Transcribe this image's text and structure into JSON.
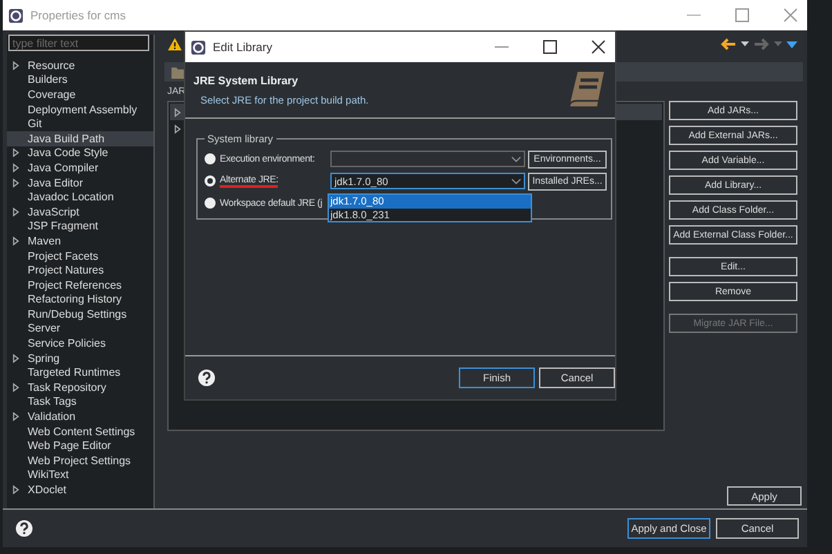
{
  "main_window": {
    "title": "Properties for cms",
    "filter": {
      "placeholder": "type filter text"
    },
    "tree": [
      {
        "label": "Resource",
        "expandable": true,
        "selected": false
      },
      {
        "label": "Builders",
        "expandable": false,
        "selected": false
      },
      {
        "label": "Coverage",
        "expandable": false,
        "selected": false
      },
      {
        "label": "Deployment Assembly",
        "expandable": false,
        "selected": false
      },
      {
        "label": "Git",
        "expandable": false,
        "selected": false
      },
      {
        "label": "Java Build Path",
        "expandable": false,
        "selected": true
      },
      {
        "label": "Java Code Style",
        "expandable": true,
        "selected": false
      },
      {
        "label": "Java Compiler",
        "expandable": true,
        "selected": false
      },
      {
        "label": "Java Editor",
        "expandable": true,
        "selected": false
      },
      {
        "label": "Javadoc Location",
        "expandable": false,
        "selected": false
      },
      {
        "label": "JavaScript",
        "expandable": true,
        "selected": false
      },
      {
        "label": "JSP Fragment",
        "expandable": false,
        "selected": false
      },
      {
        "label": "Maven",
        "expandable": true,
        "selected": false
      },
      {
        "label": "Project Facets",
        "expandable": false,
        "selected": false
      },
      {
        "label": "Project Natures",
        "expandable": false,
        "selected": false
      },
      {
        "label": "Project References",
        "expandable": false,
        "selected": false
      },
      {
        "label": "Refactoring History",
        "expandable": false,
        "selected": false
      },
      {
        "label": "Run/Debug Settings",
        "expandable": false,
        "selected": false
      },
      {
        "label": "Server",
        "expandable": false,
        "selected": false
      },
      {
        "label": "Service Policies",
        "expandable": false,
        "selected": false
      },
      {
        "label": "Spring",
        "expandable": true,
        "selected": false
      },
      {
        "label": "Targeted Runtimes",
        "expandable": false,
        "selected": false
      },
      {
        "label": "Task Repository",
        "expandable": true,
        "selected": false
      },
      {
        "label": "Task Tags",
        "expandable": false,
        "selected": false
      },
      {
        "label": "Validation",
        "expandable": true,
        "selected": false
      },
      {
        "label": "Web Content Settings",
        "expandable": false,
        "selected": false
      },
      {
        "label": "Web Page Editor",
        "expandable": false,
        "selected": false
      },
      {
        "label": "Web Project Settings",
        "expandable": false,
        "selected": false
      },
      {
        "label": "WikiText",
        "expandable": false,
        "selected": false
      },
      {
        "label": "XDoclet",
        "expandable": true,
        "selected": false
      }
    ],
    "page": {
      "tab_label": "JAR"
    },
    "side_button_groups": [
      {
        "buttons": [
          {
            "label": "Add JARs...",
            "disabled": false
          },
          {
            "label": "Add External JARs...",
            "disabled": false
          },
          {
            "label": "Add Variable...",
            "disabled": false
          },
          {
            "label": "Add Library...",
            "disabled": false
          },
          {
            "label": "Add Class Folder...",
            "disabled": false
          },
          {
            "label": "Add External Class Folder...",
            "disabled": false
          }
        ]
      },
      {
        "buttons": [
          {
            "label": "Edit...",
            "disabled": false
          },
          {
            "label": "Remove",
            "disabled": false
          }
        ]
      },
      {
        "buttons": [
          {
            "label": "Migrate JAR File...",
            "disabled": true
          }
        ]
      }
    ],
    "apply": "Apply",
    "buttons": [
      {
        "label": "Apply and Close",
        "default": true
      },
      {
        "label": "Cancel",
        "default": false
      }
    ]
  },
  "dialog": {
    "title": "Edit Library",
    "heading": "JRE System Library",
    "description": "Select JRE for the project build path.",
    "group": "System library",
    "options": [
      {
        "label": "Execution environment:",
        "selected": false,
        "underlined": false,
        "combo": {
          "disabled": true
        },
        "button": "Environments..."
      },
      {
        "label": "Alternate JRE:",
        "selected": true,
        "underlined": true,
        "combo": {
          "value": "jdk1.7.0_80",
          "disabled": false
        },
        "button": "Installed JREs..."
      },
      {
        "label": "Workspace default JRE (j",
        "selected": false,
        "underlined": false
      }
    ],
    "dropdown": [
      {
        "label": "jdk1.7.0_80",
        "selected": true
      },
      {
        "label": "jdk1.8.0_231",
        "selected": false
      }
    ],
    "buttons": [
      {
        "label": "Finish",
        "default": true
      },
      {
        "label": "Cancel",
        "default": false
      }
    ]
  }
}
